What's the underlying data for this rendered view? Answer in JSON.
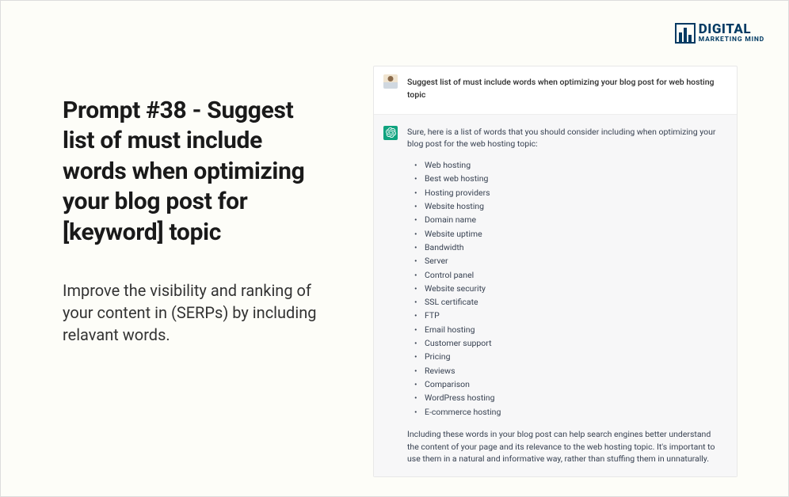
{
  "logo": {
    "line1": "DIGITAL",
    "line2": "MARKETING MIND"
  },
  "left": {
    "title": "Prompt #38 - Suggest list of must include words when optimizing your blog post for [keyword] topic",
    "subtitle": "Improve the visibility and ranking of your content in (SERPs) by including relavant words."
  },
  "chat": {
    "user_message": "Suggest list of must include words when optimizing your blog post for web hosting topic",
    "assistant_intro": "Sure, here is a list of words that you should consider including when optimizing your blog post for the web hosting topic:",
    "keywords": [
      "Web hosting",
      "Best web hosting",
      "Hosting providers",
      "Website hosting",
      "Domain name",
      "Website uptime",
      "Bandwidth",
      "Server",
      "Control panel",
      "Website security",
      "SSL certificate",
      "FTP",
      "Email hosting",
      "Customer support",
      "Pricing",
      "Reviews",
      "Comparison",
      "WordPress hosting",
      "E-commerce hosting"
    ],
    "assistant_outro": "Including these words in your blog post can help search engines better understand the content of your page and its relevance to the web hosting topic. It's important to use them in a natural and informative way, rather than stuffing them in unnaturally."
  }
}
